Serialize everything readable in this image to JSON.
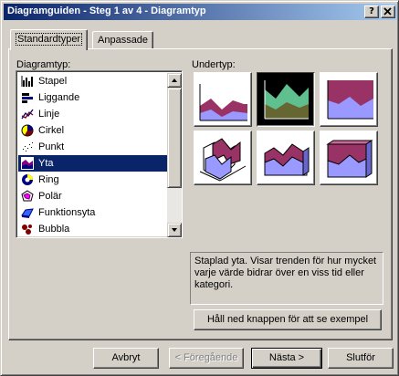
{
  "window": {
    "title": "Diagramguiden - Steg 1 av 4 - Diagramtyp",
    "help_button": "?",
    "close_button": "x"
  },
  "tabs": [
    {
      "label": "Standardtyper",
      "active": true
    },
    {
      "label": "Anpassade",
      "active": false
    }
  ],
  "chart_type_label": "Diagramtyp:",
  "chart_types": [
    {
      "label": "Stapel",
      "icon": "bar-chart-icon"
    },
    {
      "label": "Liggande",
      "icon": "horizontal-bar-chart-icon"
    },
    {
      "label": "Linje",
      "icon": "line-chart-icon"
    },
    {
      "label": "Cirkel",
      "icon": "pie-chart-icon"
    },
    {
      "label": "Punkt",
      "icon": "scatter-chart-icon"
    },
    {
      "label": "Yta",
      "icon": "area-chart-icon",
      "selected": true
    },
    {
      "label": "Ring",
      "icon": "doughnut-chart-icon"
    },
    {
      "label": "Polär",
      "icon": "radar-chart-icon"
    },
    {
      "label": "Funktionsyta",
      "icon": "surface-chart-icon"
    },
    {
      "label": "Bubbla",
      "icon": "bubble-chart-icon"
    }
  ],
  "subtype_label": "Undertyp:",
  "subtypes": [
    {
      "name": "area",
      "selected": false
    },
    {
      "name": "stacked-area",
      "selected": true
    },
    {
      "name": "100-stacked-area",
      "selected": false
    },
    {
      "name": "3d-area",
      "selected": false
    },
    {
      "name": "3d-stacked-area",
      "selected": false
    },
    {
      "name": "3d-100-stacked-area",
      "selected": false
    }
  ],
  "description": "Staplad yta. Visar trenden för hur mycket varje värde bidrar över en viss tid eller kategori.",
  "preview_button": "Håll ned knappen för att se exempel",
  "buttons": {
    "cancel": "Avbryt",
    "back": "< Föregående",
    "next": "Nästa >",
    "finish": "Slutför"
  },
  "colors": {
    "selection": "#0a246a",
    "series_purple": "#9999ff",
    "series_maroon": "#993366",
    "series_green": "#5fbf8f",
    "series_olive": "#666633"
  }
}
